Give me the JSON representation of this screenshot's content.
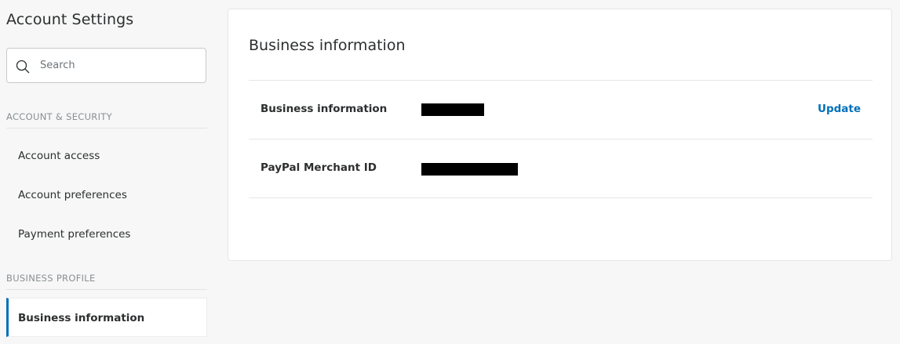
{
  "sidebar": {
    "title": "Account Settings",
    "search": {
      "placeholder": "Search",
      "value": ""
    },
    "sections": [
      {
        "header": "ACCOUNT & SECURITY",
        "items": [
          {
            "label": "Account access"
          },
          {
            "label": "Account preferences"
          },
          {
            "label": "Payment preferences"
          }
        ]
      },
      {
        "header": "BUSINESS PROFILE",
        "items": [
          {
            "label": "Business information",
            "active": true
          }
        ]
      }
    ]
  },
  "main": {
    "card_title": "Business information",
    "rows": [
      {
        "label": "Business information",
        "value": "[redacted]",
        "action": "Update"
      },
      {
        "label": "PayPal Merchant ID",
        "value": "[redacted]",
        "action": ""
      }
    ]
  },
  "colors": {
    "accent": "#0070ba",
    "redaction": "#000000",
    "background": "#f7f7f7"
  }
}
